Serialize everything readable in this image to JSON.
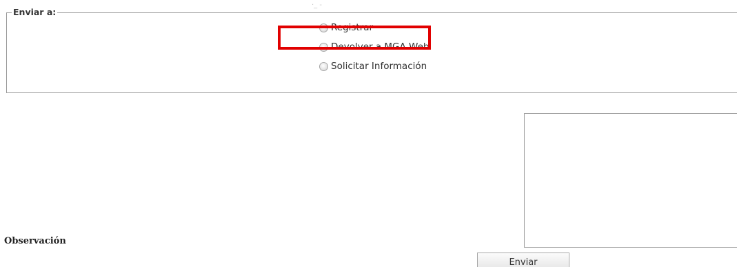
{
  "top_mark": "·_ -",
  "send_to": {
    "legend": "Enviar a:",
    "options": [
      {
        "label": "Registrar",
        "selected": false,
        "highlighted": true
      },
      {
        "label": "Devolver a MGA Web",
        "selected": false,
        "highlighted": false
      },
      {
        "label": "Solicitar Información",
        "selected": false,
        "highlighted": false
      }
    ]
  },
  "observation": {
    "label": "Observación",
    "value": ""
  },
  "actions": {
    "send_label": "Enviar"
  },
  "colors": {
    "highlight": "#e10000",
    "border": "#9a9a9a",
    "text": "#333333"
  }
}
